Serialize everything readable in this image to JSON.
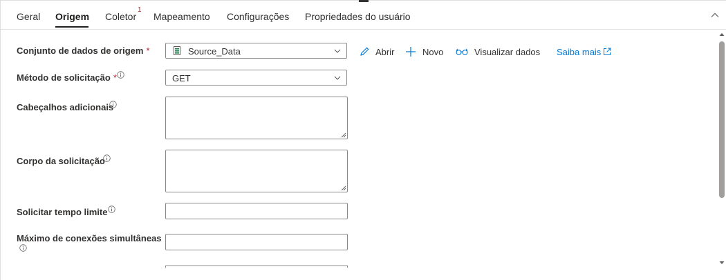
{
  "tabs": [
    {
      "label": "Geral",
      "active": false
    },
    {
      "label": "Origem",
      "active": true
    },
    {
      "label": "Coletor",
      "active": false,
      "badge": "1"
    },
    {
      "label": "Mapeamento",
      "active": false
    },
    {
      "label": "Configurações",
      "active": false
    },
    {
      "label": "Propriedades do usuário",
      "active": false
    }
  ],
  "form": {
    "dataset": {
      "label": "Conjunto de dados de origem",
      "required": "*",
      "value": "Source_Data",
      "icon": "dataset-file-icon"
    },
    "actions": {
      "open": "Abrir",
      "new": "Novo",
      "preview": "Visualizar dados",
      "learn_more": "Saiba mais"
    },
    "method": {
      "label": "Método de solicitação",
      "required": "*",
      "value": "GET"
    },
    "headers": {
      "label": "Cabeçalhos adicionais",
      "value": ""
    },
    "body": {
      "label": "Corpo da solicitação",
      "value": ""
    },
    "timeout": {
      "label": "Solicitar tempo limite",
      "value": ""
    },
    "max_connections": {
      "label": "Máximo de conexões simultâneas",
      "value": ""
    }
  },
  "colors": {
    "accent": "#0078d4",
    "required": "#a4262c",
    "border": "#8a8886"
  }
}
